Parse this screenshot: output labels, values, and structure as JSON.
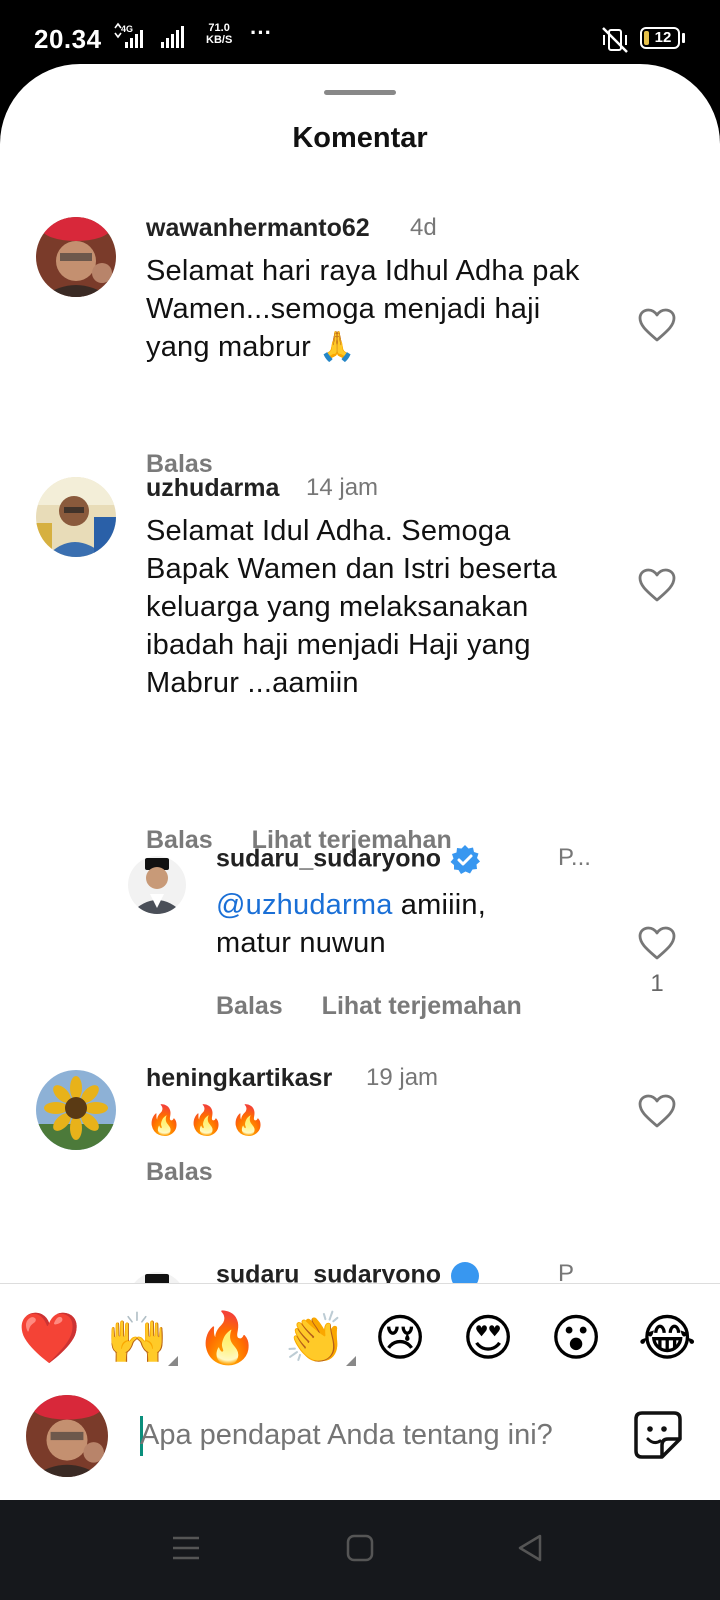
{
  "status_bar": {
    "time": "20.34",
    "network_type": "4G",
    "speed_value": "71.0",
    "speed_unit": "KB/S",
    "more": "···",
    "battery": "12"
  },
  "sheet": {
    "title": "Komentar"
  },
  "comments": [
    {
      "username": "wawanhermanto62",
      "time": "4d",
      "text": "Selamat hari raya Idhul Adha pak Wamen...semoga menjadi haji yang mabrur 🙏",
      "reply_label": "Balas",
      "translate_label": "",
      "likes": ""
    },
    {
      "username": "uzhudarma",
      "time": "14 jam",
      "text": "Selamat Idul Adha. Semoga Bapak Wamen dan Istri beserta keluarga yang melaksanakan ibadah haji menjadi Haji yang Mabrur ...aamiin",
      "reply_label": "Balas",
      "translate_label": "Lihat terjemahan",
      "likes": ""
    },
    {
      "username": "sudaru_sudaryono",
      "verified": true,
      "time": "P...",
      "mention": "@uzhudarma",
      "text": " amiiin, matur nuwun",
      "reply_label": "Balas",
      "translate_label": "Lihat terjemahan",
      "likes": "1"
    },
    {
      "username": "heningkartikasr",
      "time": "19 jam",
      "text": "🔥🔥🔥",
      "reply_label": "Balas",
      "translate_label": "",
      "likes": ""
    },
    {
      "username": "sudaru_sudaryono",
      "verified": true,
      "time": "P"
    }
  ],
  "quick_reactions": [
    "❤️",
    "🙌",
    "🔥",
    "👏",
    "😢",
    "😍",
    "😮",
    "😂"
  ],
  "composer": {
    "placeholder": "Apa pendapat Anda tentang ini?"
  },
  "colors": {
    "accent_mention": "#1a6fd6",
    "verified_badge": "#3897f0",
    "caret": "#0a8f7c"
  }
}
